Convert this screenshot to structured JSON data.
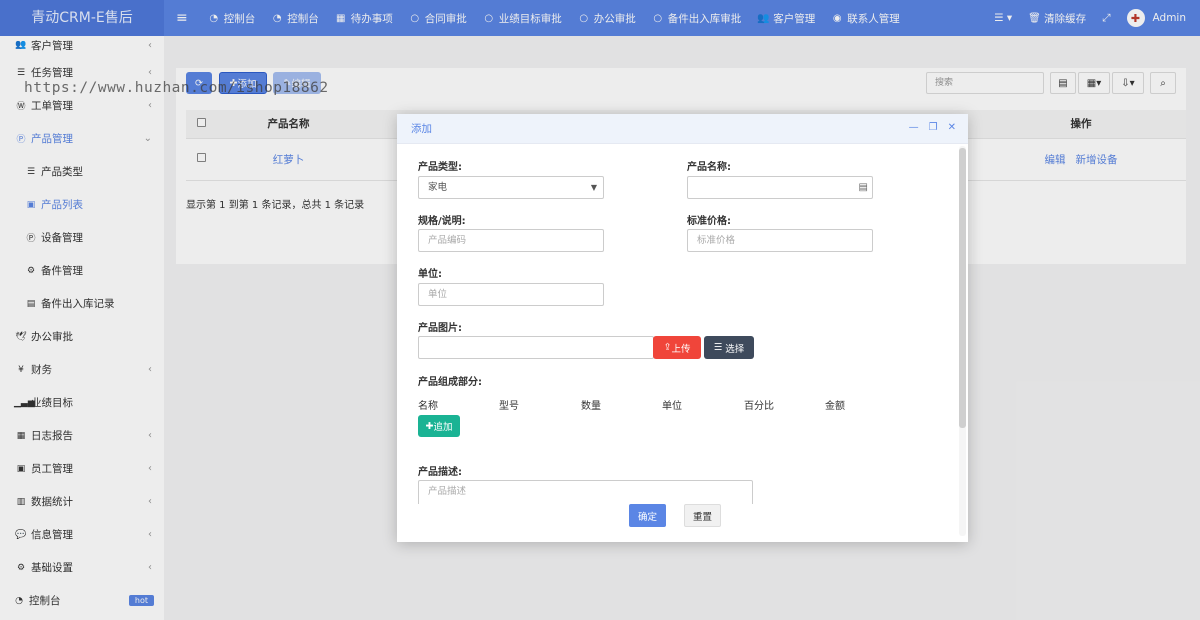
{
  "brand": "青动CRM-E售后",
  "topnav": [
    {
      "icon": "menu-icon",
      "label": ""
    },
    {
      "icon": "dashboard-icon",
      "label": "控制台"
    },
    {
      "icon": "dashboard-icon",
      "label": "控制台"
    },
    {
      "icon": "calendar-icon",
      "label": "待办事项"
    },
    {
      "icon": "circle-icon",
      "label": "合同审批"
    },
    {
      "icon": "circle-icon",
      "label": "业绩目标审批"
    },
    {
      "icon": "circle-icon",
      "label": "办公审批"
    },
    {
      "icon": "circle-icon",
      "label": "备件出入库审批"
    },
    {
      "icon": "users-icon",
      "label": "客户管理"
    },
    {
      "icon": "user-circle-icon",
      "label": "联系人管理"
    }
  ],
  "topnav_right": {
    "menu_label": "",
    "clear_cache": "清除缓存",
    "admin": "Admin"
  },
  "sidebar": [
    {
      "label": "客户管理",
      "icon": "users-icon",
      "arrow": "‹"
    },
    {
      "label": "任务管理",
      "icon": "list-icon",
      "arrow": "‹"
    },
    {
      "label": "工单管理",
      "icon": "wordpress-icon",
      "arrow": "‹"
    },
    {
      "label": "产品管理",
      "icon": "product-icon",
      "arrow": "⌄",
      "active": true
    },
    {
      "label": "产品类型",
      "icon": "bars-icon",
      "sub": true
    },
    {
      "label": "产品列表",
      "icon": "list-alt-icon",
      "sub": true,
      "active": true
    },
    {
      "label": "设备管理",
      "icon": "product-icon",
      "sub": true
    },
    {
      "label": "备件管理",
      "icon": "cogs-icon",
      "sub": true
    },
    {
      "label": "备件出入库记录",
      "icon": "table-icon",
      "sub": true
    },
    {
      "label": "办公审批",
      "icon": "twitter-icon",
      "arrow": ""
    },
    {
      "label": "财务",
      "icon": "yen-icon",
      "arrow": "‹"
    },
    {
      "label": "业绩目标",
      "icon": "signal-icon",
      "arrow": ""
    },
    {
      "label": "日志报告",
      "icon": "calendar-icon",
      "arrow": "‹"
    },
    {
      "label": "员工管理",
      "icon": "id-card-icon",
      "arrow": "‹"
    },
    {
      "label": "数据统计",
      "icon": "bar-chart-icon",
      "arrow": "‹"
    },
    {
      "label": "信息管理",
      "icon": "comments-icon",
      "arrow": "‹"
    },
    {
      "label": "基础设置",
      "icon": "cogs-icon",
      "arrow": "‹"
    },
    {
      "label": "控制台",
      "icon": "dashboard-icon",
      "badge": "hot"
    }
  ],
  "toolbar": {
    "refresh": "",
    "add": "添加",
    "edit": "编辑",
    "search_placeholder": "搜索"
  },
  "table": {
    "headers": [
      "产品名称",
      "操作"
    ],
    "rows": [
      {
        "name": "红萝卜",
        "edit": "编辑",
        "add_device": "新增设备"
      }
    ],
    "pager": "显示第 1 到第 1 条记录，总共 1 条记录"
  },
  "watermark": "https://www.huzhan.com/ishop18862",
  "modal": {
    "title": "添加",
    "product_type_label": "产品类型:",
    "product_type_value": "家电",
    "product_name_label": "产品名称:",
    "spec_label": "规格/说明:",
    "spec_placeholder": "产品编码",
    "price_label": "标准价格:",
    "price_placeholder": "标准价格",
    "unit_label": "单位:",
    "unit_placeholder": "单位",
    "image_label": "产品图片:",
    "upload_btn": "上传",
    "choose_btn": "选择",
    "parts_label": "产品组成部分:",
    "parts_columns": [
      "名称",
      "型号",
      "数量",
      "单位",
      "百分比",
      "金额"
    ],
    "parts_add_btn": "追加",
    "desc_label": "产品描述:",
    "desc_placeholder": "产品描述",
    "ok_btn": "确定",
    "reset_btn": "重置"
  },
  "colors": {
    "primary": "#5b86e5",
    "danger": "#f0453a",
    "dark": "#3e4a5c",
    "success": "#1ab394"
  }
}
